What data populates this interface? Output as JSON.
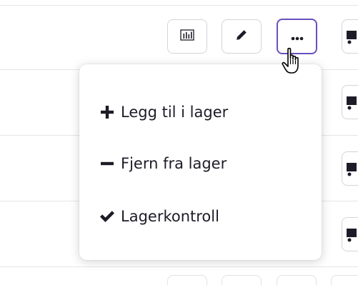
{
  "toolbar": {
    "buttons": [
      {
        "name": "statistics",
        "icon": "bar-chart-icon"
      },
      {
        "name": "edit",
        "icon": "pencil-icon"
      },
      {
        "name": "more",
        "icon": "more-dots-icon",
        "active": true
      }
    ]
  },
  "menu": {
    "items": [
      {
        "icon": "plus-icon",
        "label": "Legg til i lager"
      },
      {
        "icon": "minus-icon",
        "label": "Fjern fra lager"
      },
      {
        "icon": "check-icon",
        "label": "Lagerkontroll"
      }
    ]
  },
  "row_action_icon": "cart-icon",
  "cursor_icon": "hand-pointer-icon",
  "colors": {
    "accent": "#6a4fbf",
    "border": "#d4d4da",
    "text": "#1c1c28",
    "divider": "#e6e6ea"
  }
}
